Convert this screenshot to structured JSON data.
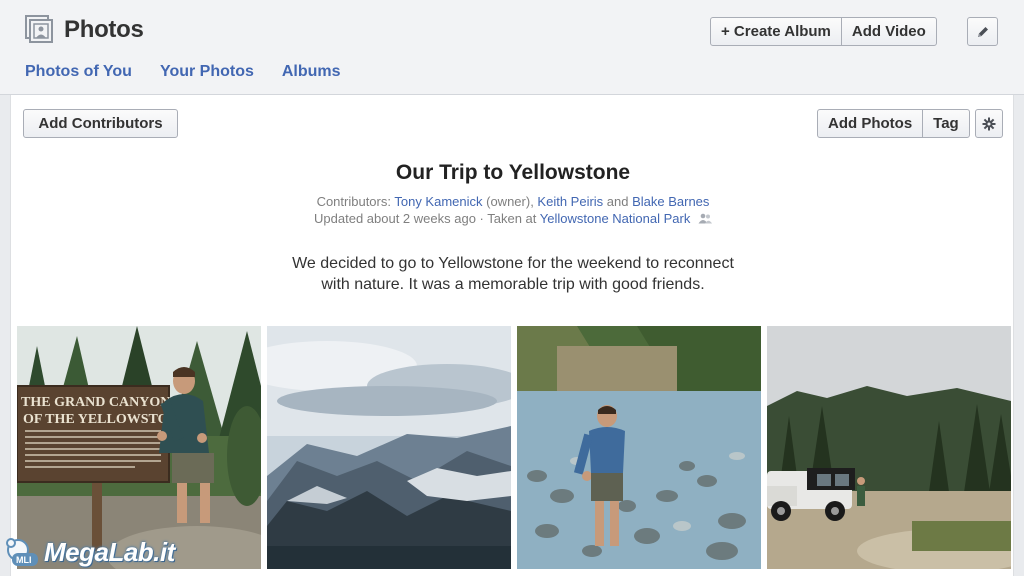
{
  "header": {
    "title": "Photos",
    "nav": [
      "Photos of You",
      "Your Photos",
      "Albums"
    ],
    "create_album": "+ Create Album",
    "add_video": "Add Video"
  },
  "toolbar": {
    "add_contributors": "Add Contributors",
    "add_photos": "Add Photos",
    "tag": "Tag"
  },
  "album": {
    "title": "Our Trip to Yellowstone",
    "contributors_prefix": "Contributors: ",
    "contributor_1": "Tony Kamenick",
    "contributor_1_role": " (owner), ",
    "contributor_2": "Keith Peiris",
    "contributors_and": " and ",
    "contributor_3": "Blake Barnes",
    "updated": "Updated about 2 weeks ago · Taken at ",
    "location": "Yellowstone National Park",
    "description_line1": "We decided to go to Yellowstone for the weekend to reconnect",
    "description_line2": "with nature. It was a memorable trip with good friends."
  },
  "photos": [
    {
      "sign_line1": "THE GRAND CANYON",
      "sign_line2": "OF THE YELLOWSTONE"
    },
    {},
    {},
    {}
  ],
  "watermark": {
    "text": "MegaLab.it",
    "badge": "MLI"
  },
  "colors": {
    "link": "#4267b2",
    "page_bg": "#e9ebee",
    "header_bg": "#f2f3f5"
  }
}
